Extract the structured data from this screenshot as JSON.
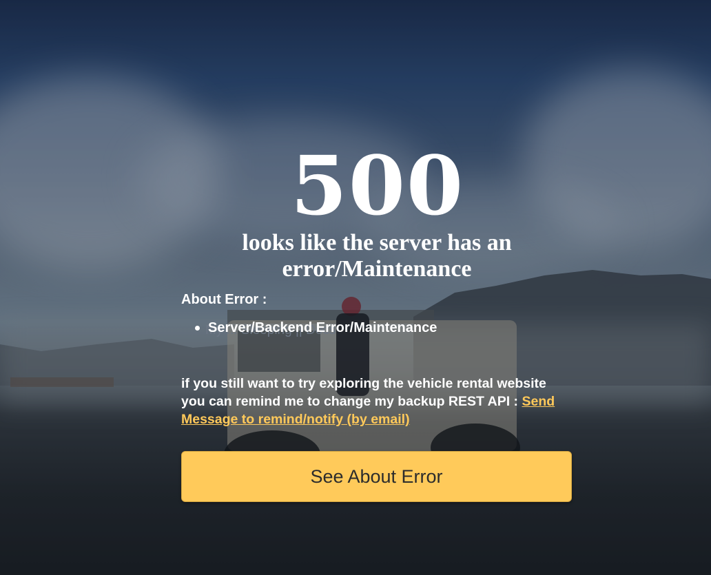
{
  "error": {
    "code": "500",
    "subtitle": "looks like the server has an error/Maintenance"
  },
  "about": {
    "title": "About Error :",
    "items": [
      "Server/Backend Error/Maintenance"
    ],
    "ghost_text": "My ... Sleeping || Docs"
  },
  "message": {
    "text": "if you still want to try exploring the vehicle rental website you can remind me to change my backup REST API : ",
    "link_label": "Send Message to remind/notify (by email)"
  },
  "button": {
    "label": "See About Error"
  },
  "colors": {
    "accent": "#ffca5a",
    "link": "#ffc95a",
    "text": "#ffffff"
  }
}
